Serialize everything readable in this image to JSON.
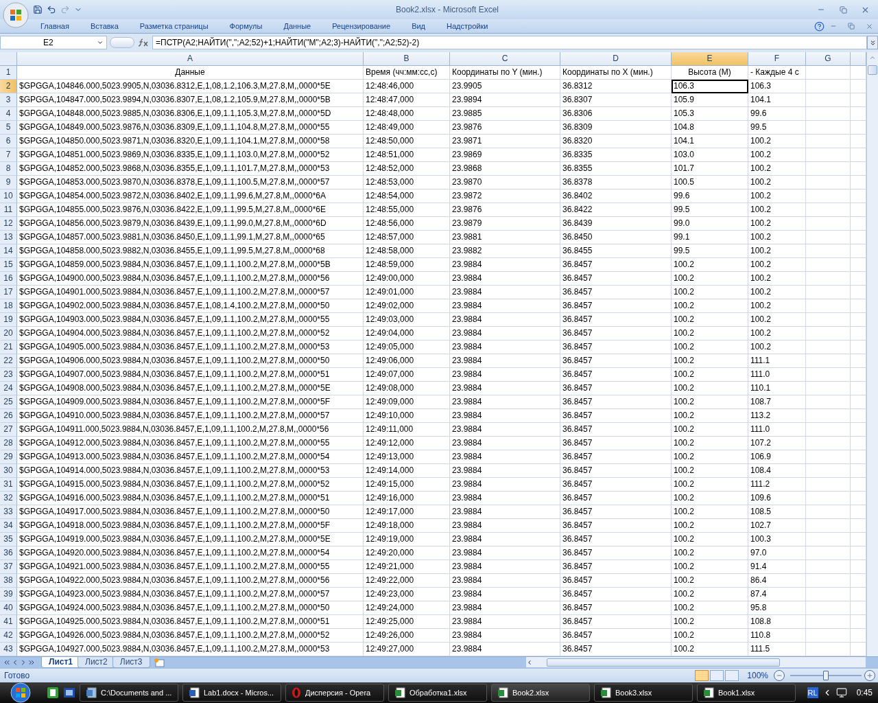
{
  "window": {
    "title": "Book2.xlsx - Microsoft Excel"
  },
  "ribbon_tabs": [
    "Главная",
    "Вставка",
    "Разметка страницы",
    "Формулы",
    "Данные",
    "Рецензирование",
    "Вид",
    "Надстройки"
  ],
  "formula_bar": {
    "name_box": "E2",
    "formula": "=ПСТР(A2;НАЙТИ(\",\";A2;52)+1;НАЙТИ(\"M\";A2;3)-НАЙТИ(\",\";A2;52)-2)"
  },
  "columns": [
    {
      "label": "A",
      "selected": false
    },
    {
      "label": "B",
      "selected": false
    },
    {
      "label": "C",
      "selected": false
    },
    {
      "label": "D",
      "selected": false
    },
    {
      "label": "E",
      "selected": true
    },
    {
      "label": "F",
      "selected": false
    },
    {
      "label": "G",
      "selected": false
    }
  ],
  "rows": [
    {
      "num": "1",
      "selected": false,
      "cells": [
        "Данные",
        "Время (чч:мм:сс,с)",
        "Координаты по Y (мин.)",
        "Координаты по X (мин.)",
        "Высота (М)",
        "- Каждые 4 с"
      ]
    },
    {
      "num": "2",
      "selected": true,
      "cells": [
        "$GPGGA,104846.000,5023.9905,N,03036.8312,E,1,08,1.2,106.3,M,27.8,M,,0000*5E",
        "12:48:46,000",
        "23.9905",
        "36.8312",
        "106.3",
        "106.3"
      ]
    },
    {
      "num": "3",
      "selected": false,
      "cells": [
        "$GPGGA,104847.000,5023.9894,N,03036.8307,E,1,08,1.2,105.9,M,27.8,M,,0000*5B",
        "12:48:47,000",
        "23.9894",
        "36.8307",
        "105.9",
        "104.1"
      ]
    },
    {
      "num": "4",
      "selected": false,
      "cells": [
        "$GPGGA,104848.000,5023.9885,N,03036.8306,E,1,09,1.1,105.3,M,27.8,M,,0000*5D",
        "12:48:48,000",
        "23.9885",
        "36.8306",
        "105.3",
        "99.6"
      ]
    },
    {
      "num": "5",
      "selected": false,
      "cells": [
        "$GPGGA,104849.000,5023.9876,N,03036.8309,E,1,09,1.1,104.8,M,27.8,M,,0000*55",
        "12:48:49,000",
        "23.9876",
        "36.8309",
        "104.8",
        "99.5"
      ]
    },
    {
      "num": "6",
      "selected": false,
      "cells": [
        "$GPGGA,104850.000,5023.9871,N,03036.8320,E,1,09,1.1,104.1,M,27.8,M,,0000*58",
        "12:48:50,000",
        "23.9871",
        "36.8320",
        "104.1",
        "100.2"
      ]
    },
    {
      "num": "7",
      "selected": false,
      "cells": [
        "$GPGGA,104851.000,5023.9869,N,03036.8335,E,1,09,1.1,103.0,M,27.8,M,,0000*52",
        "12:48:51,000",
        "23.9869",
        "36.8335",
        "103.0",
        "100.2"
      ]
    },
    {
      "num": "8",
      "selected": false,
      "cells": [
        "$GPGGA,104852.000,5023.9868,N,03036.8355,E,1,09,1.1,101.7,M,27.8,M,,0000*53",
        "12:48:52,000",
        "23.9868",
        "36.8355",
        "101.7",
        "100.2"
      ]
    },
    {
      "num": "9",
      "selected": false,
      "cells": [
        "$GPGGA,104853.000,5023.9870,N,03036.8378,E,1,09,1.1,100.5,M,27.8,M,,0000*57",
        "12:48:53,000",
        "23.9870",
        "36.8378",
        "100.5",
        "100.2"
      ]
    },
    {
      "num": "10",
      "selected": false,
      "cells": [
        "$GPGGA,104854.000,5023.9872,N,03036.8402,E,1,09,1.1,99.6,M,27.8,M,,0000*6A",
        "12:48:54,000",
        "23.9872",
        "36.8402",
        "99.6",
        "100.2"
      ]
    },
    {
      "num": "11",
      "selected": false,
      "cells": [
        "$GPGGA,104855.000,5023.9876,N,03036.8422,E,1,09,1.1,99.5,M,27.8,M,,0000*6E",
        "12:48:55,000",
        "23.9876",
        "36.8422",
        "99.5",
        "100.2"
      ]
    },
    {
      "num": "12",
      "selected": false,
      "cells": [
        "$GPGGA,104856.000,5023.9879,N,03036.8439,E,1,09,1.1,99.0,M,27.8,M,,0000*6D",
        "12:48:56,000",
        "23.9879",
        "36.8439",
        "99.0",
        "100.2"
      ]
    },
    {
      "num": "13",
      "selected": false,
      "cells": [
        "$GPGGA,104857.000,5023.9881,N,03036.8450,E,1,09,1.1,99.1,M,27.8,M,,0000*65",
        "12:48:57,000",
        "23.9881",
        "36.8450",
        "99.1",
        "100.2"
      ]
    },
    {
      "num": "14",
      "selected": false,
      "cells": [
        "$GPGGA,104858.000,5023.9882,N,03036.8455,E,1,09,1.1,99.5,M,27.8,M,,0000*68",
        "12:48:58,000",
        "23.9882",
        "36.8455",
        "99.5",
        "100.2"
      ]
    },
    {
      "num": "15",
      "selected": false,
      "cells": [
        "$GPGGA,104859.000,5023.9884,N,03036.8457,E,1,09,1.1,100.2,M,27.8,M,,0000*5B",
        "12:48:59,000",
        "23.9884",
        "36.8457",
        "100.2",
        "100.2"
      ]
    },
    {
      "num": "16",
      "selected": false,
      "cells": [
        "$GPGGA,104900.000,5023.9884,N,03036.8457,E,1,09,1.1,100.2,M,27.8,M,,0000*56",
        "12:49:00,000",
        "23.9884",
        "36.8457",
        "100.2",
        "100.2"
      ]
    },
    {
      "num": "17",
      "selected": false,
      "cells": [
        "$GPGGA,104901.000,5023.9884,N,03036.8457,E,1,09,1.1,100.2,M,27.8,M,,0000*57",
        "12:49:01,000",
        "23.9884",
        "36.8457",
        "100.2",
        "100.2"
      ]
    },
    {
      "num": "18",
      "selected": false,
      "cells": [
        "$GPGGA,104902.000,5023.9884,N,03036.8457,E,1,08,1.4,100.2,M,27.8,M,,0000*50",
        "12:49:02,000",
        "23.9884",
        "36.8457",
        "100.2",
        "100.2"
      ]
    },
    {
      "num": "19",
      "selected": false,
      "cells": [
        "$GPGGA,104903.000,5023.9884,N,03036.8457,E,1,09,1.1,100.2,M,27.8,M,,0000*55",
        "12:49:03,000",
        "23.9884",
        "36.8457",
        "100.2",
        "100.2"
      ]
    },
    {
      "num": "20",
      "selected": false,
      "cells": [
        "$GPGGA,104904.000,5023.9884,N,03036.8457,E,1,09,1.1,100.2,M,27.8,M,,0000*52",
        "12:49:04,000",
        "23.9884",
        "36.8457",
        "100.2",
        "100.2"
      ]
    },
    {
      "num": "21",
      "selected": false,
      "cells": [
        "$GPGGA,104905.000,5023.9884,N,03036.8457,E,1,09,1.1,100.2,M,27.8,M,,0000*53",
        "12:49:05,000",
        "23.9884",
        "36.8457",
        "100.2",
        "100.2"
      ]
    },
    {
      "num": "22",
      "selected": false,
      "cells": [
        "$GPGGA,104906.000,5023.9884,N,03036.8457,E,1,09,1.1,100.2,M,27.8,M,,0000*50",
        "12:49:06,000",
        "23.9884",
        "36.8457",
        "100.2",
        "111.1"
      ]
    },
    {
      "num": "23",
      "selected": false,
      "cells": [
        "$GPGGA,104907.000,5023.9884,N,03036.8457,E,1,09,1.1,100.2,M,27.8,M,,0000*51",
        "12:49:07,000",
        "23.9884",
        "36.8457",
        "100.2",
        "111.0"
      ]
    },
    {
      "num": "24",
      "selected": false,
      "cells": [
        "$GPGGA,104908.000,5023.9884,N,03036.8457,E,1,09,1.1,100.2,M,27.8,M,,0000*5E",
        "12:49:08,000",
        "23.9884",
        "36.8457",
        "100.2",
        "110.1"
      ]
    },
    {
      "num": "25",
      "selected": false,
      "cells": [
        "$GPGGA,104909.000,5023.9884,N,03036.8457,E,1,09,1.1,100.2,M,27.8,M,,0000*5F",
        "12:49:09,000",
        "23.9884",
        "36.8457",
        "100.2",
        "108.7"
      ]
    },
    {
      "num": "26",
      "selected": false,
      "cells": [
        "$GPGGA,104910.000,5023.9884,N,03036.8457,E,1,09,1.1,100.2,M,27.8,M,,0000*57",
        "12:49:10,000",
        "23.9884",
        "36.8457",
        "100.2",
        "113.2"
      ]
    },
    {
      "num": "27",
      "selected": false,
      "cells": [
        "$GPGGA,104911.000,5023.9884,N,03036.8457,E,1,09,1.1,100.2,M,27.8,M,,0000*56",
        "12:49:11,000",
        "23.9884",
        "36.8457",
        "100.2",
        "111.0"
      ]
    },
    {
      "num": "28",
      "selected": false,
      "cells": [
        "$GPGGA,104912.000,5023.9884,N,03036.8457,E,1,09,1.1,100.2,M,27.8,M,,0000*55",
        "12:49:12,000",
        "23.9884",
        "36.8457",
        "100.2",
        "107.2"
      ]
    },
    {
      "num": "29",
      "selected": false,
      "cells": [
        "$GPGGA,104913.000,5023.9884,N,03036.8457,E,1,09,1.1,100.2,M,27.8,M,,0000*54",
        "12:49:13,000",
        "23.9884",
        "36.8457",
        "100.2",
        "106.9"
      ]
    },
    {
      "num": "30",
      "selected": false,
      "cells": [
        "$GPGGA,104914.000,5023.9884,N,03036.8457,E,1,09,1.1,100.2,M,27.8,M,,0000*53",
        "12:49:14,000",
        "23.9884",
        "36.8457",
        "100.2",
        "108.4"
      ]
    },
    {
      "num": "31",
      "selected": false,
      "cells": [
        "$GPGGA,104915.000,5023.9884,N,03036.8457,E,1,09,1.1,100.2,M,27.8,M,,0000*52",
        "12:49:15,000",
        "23.9884",
        "36.8457",
        "100.2",
        "111.2"
      ]
    },
    {
      "num": "32",
      "selected": false,
      "cells": [
        "$GPGGA,104916.000,5023.9884,N,03036.8457,E,1,09,1.1,100.2,M,27.8,M,,0000*51",
        "12:49:16,000",
        "23.9884",
        "36.8457",
        "100.2",
        "109.6"
      ]
    },
    {
      "num": "33",
      "selected": false,
      "cells": [
        "$GPGGA,104917.000,5023.9884,N,03036.8457,E,1,09,1.1,100.2,M,27.8,M,,0000*50",
        "12:49:17,000",
        "23.9884",
        "36.8457",
        "100.2",
        "108.5"
      ]
    },
    {
      "num": "34",
      "selected": false,
      "cells": [
        "$GPGGA,104918.000,5023.9884,N,03036.8457,E,1,09,1.1,100.2,M,27.8,M,,0000*5F",
        "12:49:18,000",
        "23.9884",
        "36.8457",
        "100.2",
        "102.7"
      ]
    },
    {
      "num": "35",
      "selected": false,
      "cells": [
        "$GPGGA,104919.000,5023.9884,N,03036.8457,E,1,09,1.1,100.2,M,27.8,M,,0000*5E",
        "12:49:19,000",
        "23.9884",
        "36.8457",
        "100.2",
        "100.3"
      ]
    },
    {
      "num": "36",
      "selected": false,
      "cells": [
        "$GPGGA,104920.000,5023.9884,N,03036.8457,E,1,09,1.1,100.2,M,27.8,M,,0000*54",
        "12:49:20,000",
        "23.9884",
        "36.8457",
        "100.2",
        "97.0"
      ]
    },
    {
      "num": "37",
      "selected": false,
      "cells": [
        "$GPGGA,104921.000,5023.9884,N,03036.8457,E,1,09,1.1,100.2,M,27.8,M,,0000*55",
        "12:49:21,000",
        "23.9884",
        "36.8457",
        "100.2",
        "91.4"
      ]
    },
    {
      "num": "38",
      "selected": false,
      "cells": [
        "$GPGGA,104922.000,5023.9884,N,03036.8457,E,1,09,1.1,100.2,M,27.8,M,,0000*56",
        "12:49:22,000",
        "23.9884",
        "36.8457",
        "100.2",
        "86.4"
      ]
    },
    {
      "num": "39",
      "selected": false,
      "cells": [
        "$GPGGA,104923.000,5023.9884,N,03036.8457,E,1,09,1.1,100.2,M,27.8,M,,0000*57",
        "12:49:23,000",
        "23.9884",
        "36.8457",
        "100.2",
        "87.4"
      ]
    },
    {
      "num": "40",
      "selected": false,
      "cells": [
        "$GPGGA,104924.000,5023.9884,N,03036.8457,E,1,09,1.1,100.2,M,27.8,M,,0000*50",
        "12:49:24,000",
        "23.9884",
        "36.8457",
        "100.2",
        "95.8"
      ]
    },
    {
      "num": "41",
      "selected": false,
      "cells": [
        "$GPGGA,104925.000,5023.9884,N,03036.8457,E,1,09,1.1,100.2,M,27.8,M,,0000*51",
        "12:49:25,000",
        "23.9884",
        "36.8457",
        "100.2",
        "108.8"
      ]
    },
    {
      "num": "42",
      "selected": false,
      "cells": [
        "$GPGGA,104926.000,5023.9884,N,03036.8457,E,1,09,1.1,100.2,M,27.8,M,,0000*52",
        "12:49:26,000",
        "23.9884",
        "36.8457",
        "100.2",
        "110.8"
      ]
    },
    {
      "num": "43",
      "selected": false,
      "cells": [
        "$GPGGA,104927.000,5023.9884,N,03036.8457,E,1,09,1.1,100.2,M,27.8,M,,0000*53",
        "12:49:27,000",
        "23.9884",
        "36.8457",
        "100.2",
        "111.5"
      ]
    }
  ],
  "sheet_tabs": [
    {
      "label": "Лист1",
      "selected": true
    },
    {
      "label": "Лист2",
      "selected": false
    },
    {
      "label": "Лист3",
      "selected": false
    }
  ],
  "status_bar": {
    "text": "Готово",
    "views": [
      {
        "selected": true
      },
      {
        "selected": false
      },
      {
        "selected": false
      }
    ],
    "zoom": "100%",
    "zoom_slider": {
      "level": 0.5
    }
  },
  "taskbar": {
    "items": [
      {
        "kind": "explorer",
        "label": "C:\\Documents and ...",
        "selected": false
      },
      {
        "kind": "word",
        "label": "Lab1.docx - Micros...",
        "selected": false
      },
      {
        "kind": "opera",
        "label": "Дисперсия - Opera",
        "selected": false
      },
      {
        "kind": "excel",
        "label": "Обработка1.xlsx",
        "selected": false
      },
      {
        "kind": "excel",
        "label": "Book2.xlsx",
        "selected": true
      },
      {
        "kind": "excel",
        "label": "Book3.xlsx",
        "selected": false
      },
      {
        "kind": "excel",
        "label": "Book1.xlsx",
        "selected": false
      }
    ],
    "language": "RL",
    "clock": "0:45"
  }
}
